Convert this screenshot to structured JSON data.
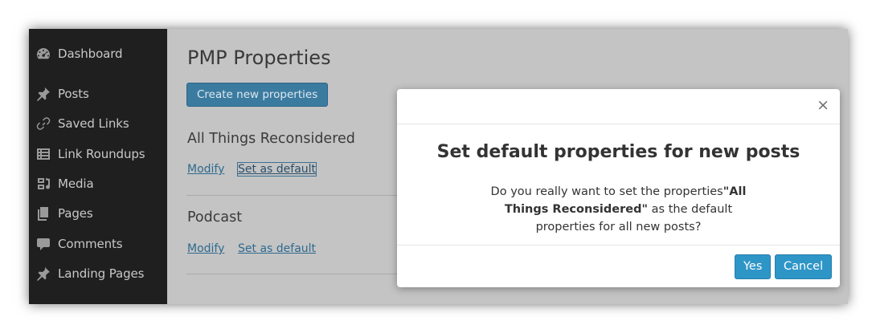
{
  "sidebar": {
    "items": [
      {
        "label": "Dashboard",
        "icon": "dashboard-icon"
      },
      {
        "label": "Posts",
        "icon": "pin-icon"
      },
      {
        "label": "Saved Links",
        "icon": "link-icon"
      },
      {
        "label": "Link Roundups",
        "icon": "list-icon"
      },
      {
        "label": "Media",
        "icon": "media-icon"
      },
      {
        "label": "Pages",
        "icon": "pages-icon"
      },
      {
        "label": "Comments",
        "icon": "comment-icon"
      },
      {
        "label": "Landing Pages",
        "icon": "pin-icon"
      }
    ]
  },
  "main": {
    "title": "PMP Properties",
    "create_button": "Create new properties",
    "properties": [
      {
        "name": "All Things Reconsidered",
        "modify": "Modify",
        "set_default": "Set as default"
      },
      {
        "name": "Podcast",
        "modify": "Modify",
        "set_default": "Set as default"
      }
    ]
  },
  "modal": {
    "close": "×",
    "title": "Set default properties for new posts",
    "text_before": "Do you really want to set the properties",
    "text_highlight": "\"All Things Reconsidered\"",
    "text_after": " as the default properties for all new posts?",
    "yes": "Yes",
    "cancel": "Cancel"
  },
  "colors": {
    "primary_button": "#2e95c7",
    "link": "#2e6a8f",
    "sidebar_bg": "#1e1e1e"
  }
}
